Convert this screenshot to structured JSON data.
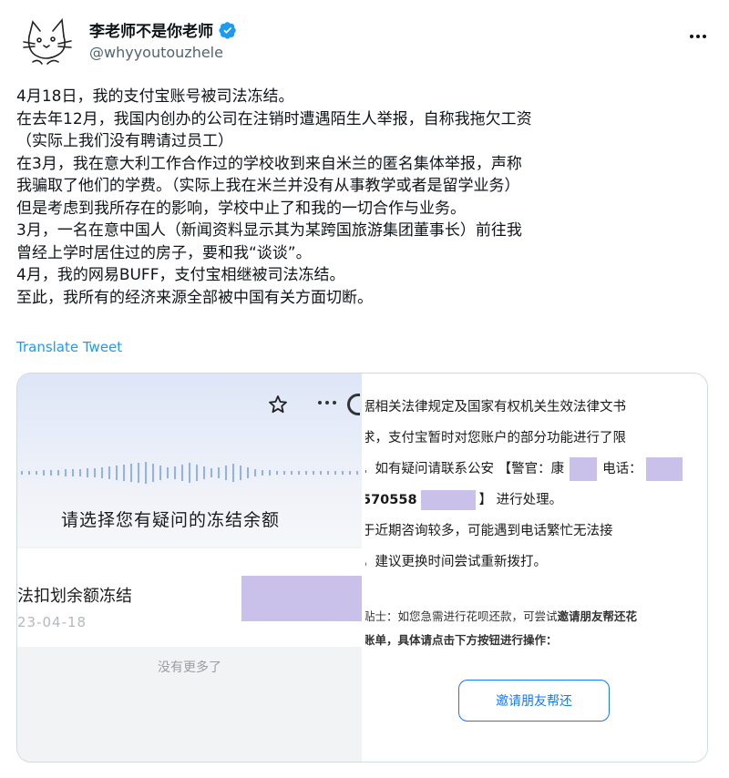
{
  "author": {
    "display_name": "李老师不是你老师",
    "handle": "@whyyoutouzhele"
  },
  "tweet": {
    "lines": [
      "4月18日，我的支付宝账号被司法冻结。",
      "在去年12月，我国内创办的公司在注销时遭遇陌生人举报，自称我拖欠工资",
      "（实际上我们没有聘请过员工）",
      "在3月，我在意大利工作合作过的学校收到来自米兰的匿名集体举报，声称",
      "我骗取了他们的学费。（实际上我在米兰并没有从事教学或者是留学业务）",
      "但是考虑到我所存在的影响，学校中止了和我的一切合作与业务。",
      "3月，一名在意中国人（新闻资料显示其为某跨国旅游集团董事长）前往我",
      "曾经上学时居住过的房子，要和我“谈谈”。",
      "4月，我的网易BUFF，支付宝相继被司法冻结。",
      "至此，我所有的经济来源全部被中国有关方面切断。"
    ],
    "translate_label": "Translate Tweet"
  },
  "media_left": {
    "prompt": "请选择您有疑问的冻结余额",
    "record_title": "法扣划余额冻结",
    "record_date": "23-04-18",
    "no_more": "没有更多了"
  },
  "media_right": {
    "notice_lines": {
      "l1": "据相关法律规定及国家有权机关生效法律文书",
      "l2": "求，支付宝暂时对您账户的部分功能进行了限",
      "l3a": "。如有疑问请联系公安 【警官：康",
      "l3b": "电话：",
      "l4a": "570558",
      "l4b": "】 进行处理。",
      "l5": "于近期咨询较多，可能遇到电话繁忙无法接",
      "l6": "，建议更换时间尝试重新拨打。"
    },
    "tip_lines": {
      "t1a": "贴士：如您急需进行花呗还款，可尝试",
      "t1b": "邀请朋友帮还花",
      "t2": "账单，具体请点击下方按钮进行操作："
    },
    "invite_button": "邀请朋友帮还"
  },
  "colors": {
    "link": "#1d9bf0",
    "verified": "#1d9bf0",
    "redaction": "#c9c1ea",
    "alipay_blue": "#1677ff"
  }
}
